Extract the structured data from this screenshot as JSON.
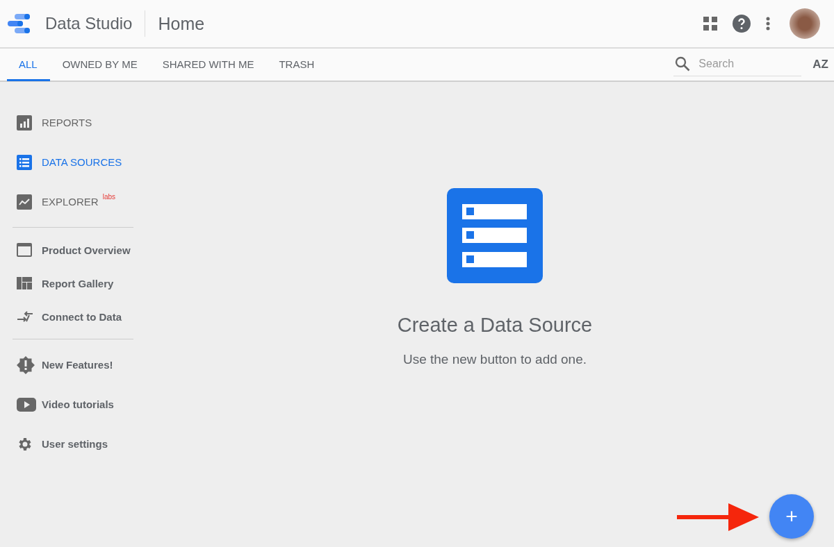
{
  "header": {
    "app_name": "Data Studio",
    "page_title": "Home"
  },
  "tabs": [
    {
      "label": "ALL",
      "selected": true
    },
    {
      "label": "OWNED BY ME",
      "selected": false
    },
    {
      "label": "SHARED WITH ME",
      "selected": false
    },
    {
      "label": "TRASH",
      "selected": false
    }
  ],
  "search": {
    "placeholder": "Search"
  },
  "sort_button": {
    "label": "AZ"
  },
  "sidebar": {
    "sections": [
      {
        "items": [
          {
            "kind": "nav",
            "label": "REPORTS",
            "selected": false
          },
          {
            "kind": "nav",
            "label": "DATA SOURCES",
            "selected": true
          },
          {
            "kind": "nav",
            "label": "EXPLORER",
            "badge": "labs",
            "selected": false
          }
        ]
      },
      {
        "items": [
          {
            "kind": "link",
            "label": "Product Overview"
          },
          {
            "kind": "link",
            "label": "Report Gallery"
          },
          {
            "kind": "link",
            "label": "Connect to Data"
          }
        ]
      },
      {
        "items": [
          {
            "kind": "link",
            "label": "New Features!"
          },
          {
            "kind": "link",
            "label": "Video tutorials"
          },
          {
            "kind": "link",
            "label": "User settings"
          }
        ]
      }
    ]
  },
  "empty_state": {
    "title": "Create a Data Source",
    "message": "Use the new button to add one."
  },
  "fab": {
    "label": "+"
  }
}
